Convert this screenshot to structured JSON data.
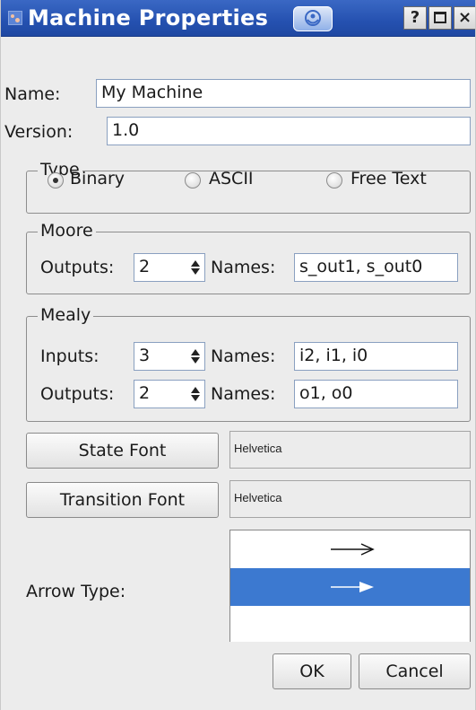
{
  "window": {
    "title": "Machine Properties"
  },
  "name": {
    "label": "Name:",
    "value": "My Machine"
  },
  "version": {
    "label": "Version:",
    "value": "1.0"
  },
  "type_group": {
    "title": "Type",
    "options": [
      {
        "label": "Binary",
        "checked": true
      },
      {
        "label": "ASCII",
        "checked": false
      },
      {
        "label": "Free Text",
        "checked": false
      }
    ]
  },
  "moore": {
    "title": "Moore",
    "outputs_label": "Outputs:",
    "outputs_value": "2",
    "names_label": "Names:",
    "names_value": "s_out1, s_out0"
  },
  "mealy": {
    "title": "Mealy",
    "inputs_label": "Inputs:",
    "inputs_value": "3",
    "inputs_names_label": "Names:",
    "inputs_names_value": "i2, i1, i0",
    "outputs_label": "Outputs:",
    "outputs_value": "2",
    "outputs_names_label": "Names:",
    "outputs_names_value": "o1, o0"
  },
  "fonts": {
    "state_button": "State Font",
    "state_value": "Helvetica",
    "transition_button": "Transition Font",
    "transition_value": "Helvetica"
  },
  "arrow_type": {
    "label": "Arrow Type:",
    "items": [
      "open-arrow",
      "filled-arrow"
    ],
    "selected_index": 1
  },
  "dialog_buttons": {
    "ok": "OK",
    "cancel": "Cancel"
  },
  "colors": {
    "titlebar": "#2551b0",
    "selection": "#3c79d0",
    "dialog_bg": "#ececec"
  }
}
